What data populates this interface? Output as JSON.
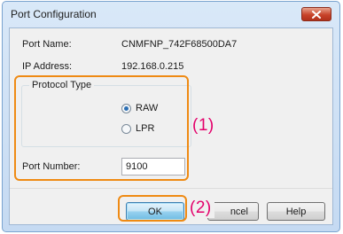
{
  "dialog": {
    "title": "Port Configuration",
    "close_icon": "close-icon"
  },
  "fields": {
    "port_name_label": "Port Name:",
    "port_name_value": "CNMFNP_742F68500DA7",
    "ip_address_label": "IP Address:",
    "ip_address_value": "192.168.0.215"
  },
  "protocol": {
    "legend": "Protocol Type",
    "options": [
      {
        "label": "RAW",
        "selected": true
      },
      {
        "label": "LPR",
        "selected": false
      }
    ]
  },
  "port_number": {
    "label": "Port Number:",
    "value": "9100"
  },
  "annotations": {
    "callout_1": "(1)",
    "callout_2": "(2)",
    "highlight_color": "#ef8a13",
    "callout_color": "#e3006b"
  },
  "buttons": {
    "ok": "OK",
    "cancel_visible": "ncel",
    "help": "Help"
  }
}
